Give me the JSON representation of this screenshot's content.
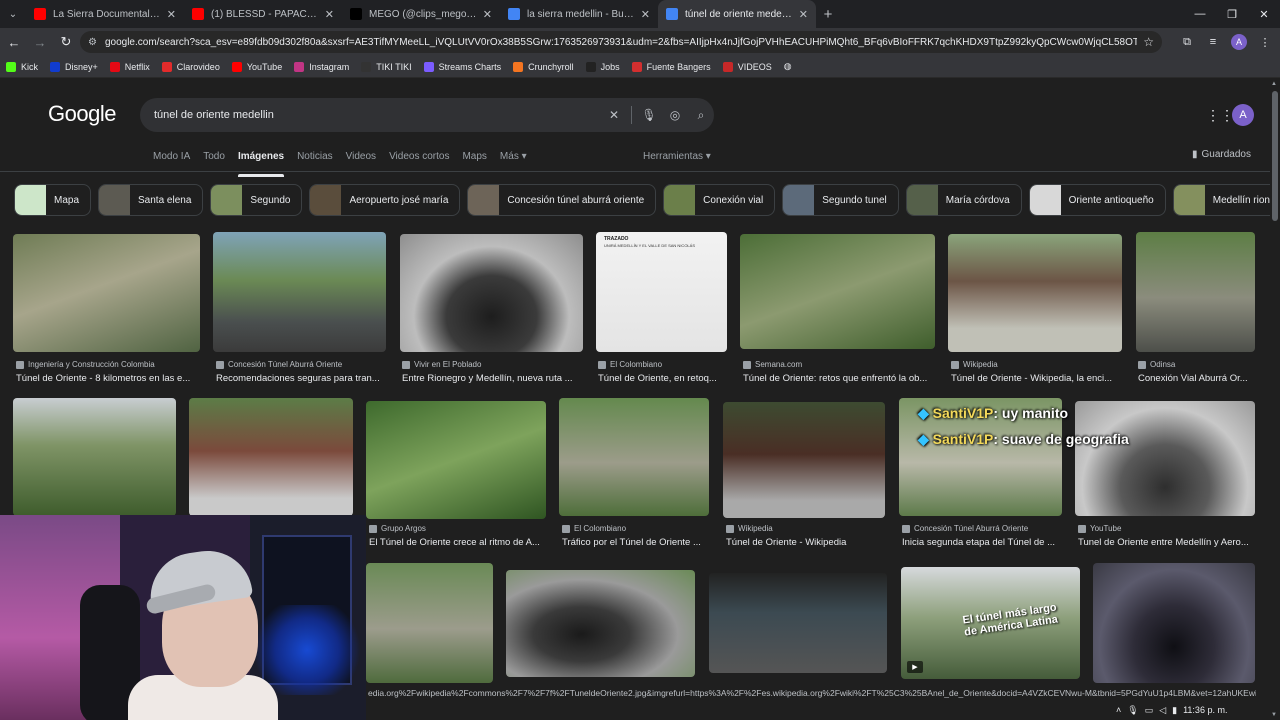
{
  "browser": {
    "tabs": [
      {
        "title": "La Sierra Documental Película c",
        "icon": "youtube-icon",
        "color": "#ff0000"
      },
      {
        "title": "(1) BLESSD - PAPACITO 💜 (VID",
        "icon": "youtube-icon",
        "color": "#ff0000"
      },
      {
        "title": "MEGO (@clips_megonorrea) | T",
        "icon": "tiktok-icon",
        "color": "#000000"
      },
      {
        "title": "la sierra medellin - Buscar con G",
        "icon": "google-icon",
        "color": "#4285f4"
      },
      {
        "title": "túnel de oriente medellin - Busc",
        "icon": "google-icon",
        "color": "#4285f4"
      }
    ],
    "active_tab": 4,
    "url": "google.com/search?sca_esv=e89fdb09d302f80a&sxsrf=AE3TifMYMeeLL_iVQLUtVV0rOx38B5SGrw:1763526973931&udm=2&fbs=AIIjpHx4nJjfGojPVHhEACUHPiMQht6_BFq6vBIoFFRK7qchKHDX9TtpZ992kyQpCWcw0WjqCL58OT9xzaJZWNwg8Tb-Qm...",
    "bookmarks": [
      "Kick",
      "Disney+",
      "Netflix",
      "Clarovideo",
      "YouTube",
      "Instagram",
      "TIKI TIKI",
      "Streams Charts",
      "Crunchyroll",
      "Jobs",
      "Fuente Bangers",
      "VIDEOS"
    ],
    "bookmark_colors": [
      "#53fc18",
      "#113ccf",
      "#e50914",
      "#e32b2b",
      "#ff0000",
      "#c13584",
      "#333333",
      "#7b5cff",
      "#f47521",
      "#222222",
      "#d32f2f",
      "#c62828"
    ]
  },
  "google": {
    "logo": "Google",
    "query": "túnel de oriente medellin",
    "tabs": [
      "Modo IA",
      "Todo",
      "Imágenes",
      "Noticias",
      "Videos",
      "Videos cortos",
      "Maps",
      "Más"
    ],
    "active_tab": 2,
    "tools_label": "Herramientas",
    "saved_label": "Guardados",
    "avatar_letter": "A",
    "chips": [
      "Mapa",
      "Santa elena",
      "Segundo",
      "Aeropuerto josé maría",
      "Concesión túnel aburrá oriente",
      "Conexión vial",
      "Segundo tunel",
      "María córdova",
      "Oriente antioqueño",
      "Medellín rionegro a"
    ],
    "results": [
      {
        "source": "Ingeniería y Construcción Colombia",
        "title": "Túnel de Oriente - 8 kilometros en las e..."
      },
      {
        "source": "Concesión Túnel Aburrá Oriente",
        "title": "Recomendaciones seguras para tran..."
      },
      {
        "source": "Vivir en El Poblado",
        "title": "Entre Rionegro y Medellín, nueva ruta ..."
      },
      {
        "source": "El Colombiano",
        "title": "Túnel de Oriente, en retoq..."
      },
      {
        "source": "Semana.com",
        "title": "Túnel de Oriente: retos que enfrentó la ob..."
      },
      {
        "source": "Wikipedia",
        "title": "Túnel de Oriente - Wikipedia, la enci..."
      },
      {
        "source": "Odinsa",
        "title": "Conexión Vial Aburrá Or..."
      },
      {
        "source": "Grupo Argos",
        "title": "El Túnel de Oriente crece al ritmo de A..."
      },
      {
        "source": "El Colombiano",
        "title": "Tráfico por el Túnel de Oriente ..."
      },
      {
        "source": "Wikipedia",
        "title": "Túnel de Oriente - Wikipedia"
      },
      {
        "source": "Concesión Túnel Aburrá Oriente",
        "title": "Inicia segunda etapa del Túnel de ..."
      },
      {
        "source": "YouTube",
        "title": "Tunel de Oriente entre Medellín y Aero..."
      }
    ],
    "overlay_chat": [
      {
        "user": "SantiV1P",
        "text": ": uy manito"
      },
      {
        "user": "SantiV1P",
        "text": ": suave de geografia"
      }
    ],
    "map_thumb_title": "TRAZADO",
    "map_thumb_sub": "UNIRÁ MEDELLÍN Y EL VALLE DE SAN NICOLÁS",
    "watermark_text": "El túnel más largo de América Latina"
  },
  "status_url": "edia.org%2Fwikipedia%2Fcommons%2F7%2F7f%2FTuneldeOriente2.jpg&imgrefurl=https%3A%2F%2Fes.wikipedia.org%2Fwiki%2FT%25C3%25BAnel_de_Oriente&docid=A4VZkCEVNwu-M&tbnid=5PGdYuU1p4LBM&vet=12ahUKEwiim6D4sf2QAxUN...",
  "taskbar": {
    "time": "11:36 p. m."
  }
}
